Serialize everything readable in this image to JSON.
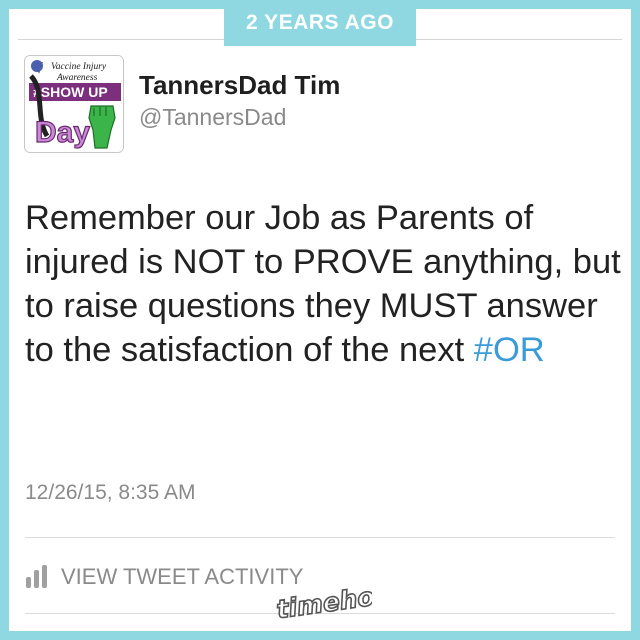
{
  "badge": {
    "label": "2 YEARS AGO"
  },
  "profile": {
    "name": "TannersDad Tim",
    "handle": "@TannersDad",
    "avatar_text": {
      "line1": "Vaccine Injury",
      "line2": "Awareness",
      "line3": "#SHOW UP",
      "line4": "Day"
    }
  },
  "tweet": {
    "text_plain": "Remember our Job as Parents of injured is NOT to PROVE anything, but to raise questions they MUST answer to the satisfaction of the next ",
    "hashtag": "#OR",
    "timestamp": "12/26/15, 8:35 AM"
  },
  "activity": {
    "label": "VIEW TWEET ACTIVITY",
    "icon": "bar-chart-icon"
  },
  "watermark": {
    "text": "timehop"
  },
  "colors": {
    "frame": "#8fd8e2",
    "hashtag": "#3a9bd9",
    "muted_text": "#8a8a8a",
    "avatar_banner": "#7b2f7d",
    "avatar_green": "#3bb54a"
  }
}
